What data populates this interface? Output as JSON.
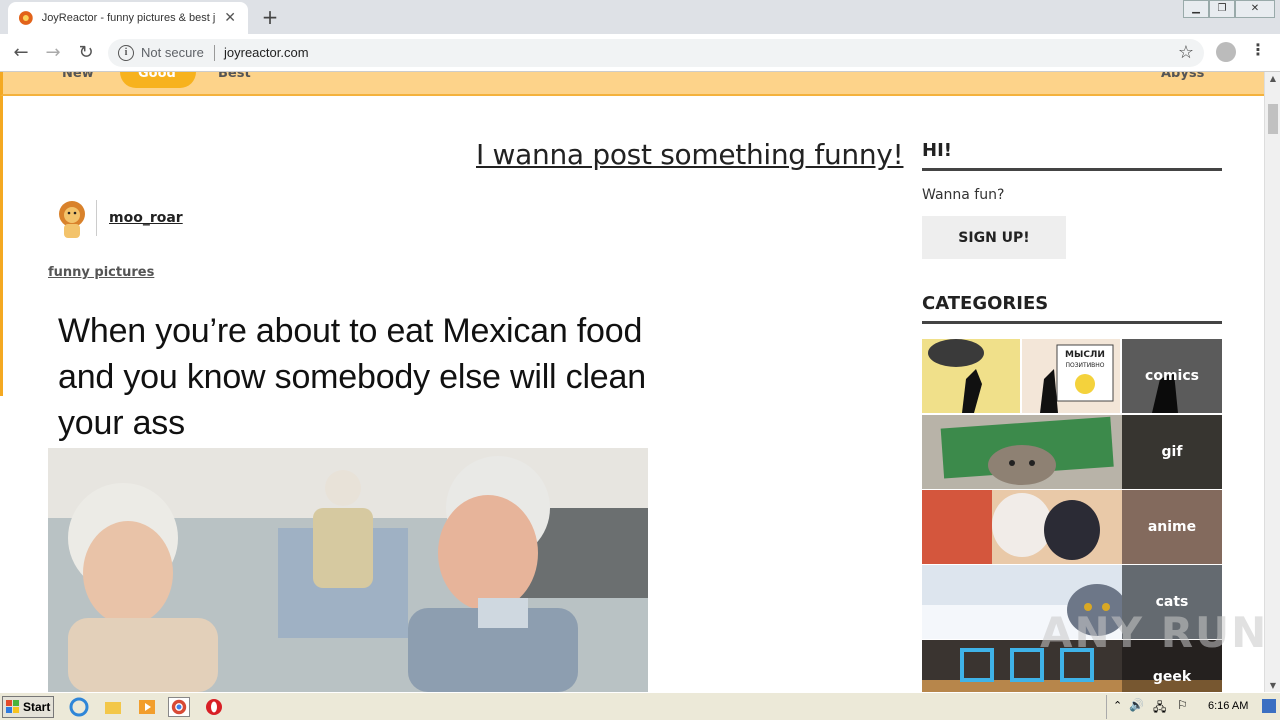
{
  "browser": {
    "tab_title": "JoyReactor - funny pictures & best j",
    "new_tab_label": "+",
    "close_tab_label": "✕",
    "security_label": "Not secure",
    "url": "joyreactor.com"
  },
  "topnav": {
    "items": [
      "New",
      "Good",
      "Best"
    ],
    "active": "Good",
    "right_item": "Abyss"
  },
  "post": {
    "link_text": "I wanna post something funny!",
    "username": "moo_roar",
    "tag": "funny pictures",
    "meme_caption": "When you’re about to eat Mexican food and you know somebody else will clean your ass"
  },
  "sidebar": {
    "hi_heading": "HI!",
    "hi_text": "Wanna fun?",
    "signup_label": "SIGN UP!",
    "categories_heading": "CATEGORIES",
    "categories": [
      "comics",
      "gif",
      "anime",
      "cats",
      "geek"
    ],
    "comic_sign_text": [
      "МЫСЛИ",
      "ПОЗИТИВНО"
    ]
  },
  "watermark": "ANY RUN",
  "taskbar": {
    "start_label": "Start",
    "clock": "6:16 AM"
  },
  "colors": {
    "nav_bg": "#fdd38a",
    "nav_active": "#f7b21e",
    "accent": "#f4a922"
  }
}
